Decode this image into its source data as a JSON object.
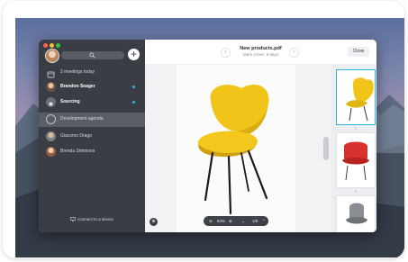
{
  "sidebar": {
    "items": [
      {
        "label": "2 meetings today",
        "bold": false
      },
      {
        "label": "Brandon Seager",
        "bold": true,
        "unread": true
      },
      {
        "label": "Sourcing",
        "bold": true,
        "unread": true
      },
      {
        "label": "Development agenda",
        "bold": false,
        "active": true
      },
      {
        "label": "Giacomo Drago",
        "bold": false
      },
      {
        "label": "Brenda Simmons",
        "bold": false
      }
    ],
    "connect_label": "Connect to a device",
    "compose_label": "+"
  },
  "viewer": {
    "title": "New products.pdf",
    "subtitle": "Mark Jones, 8 days",
    "close_label": "Close",
    "zoom": "84%",
    "page_indicator": "1/6",
    "thumb_numbers": [
      "1",
      "2"
    ]
  },
  "colors": {
    "accent": "#2fb5e9",
    "sidebar_bg": "#3a3d44",
    "chair_yellow": "#f0c419",
    "chair_red": "#d8312d",
    "chair_gray": "#8a8d92"
  },
  "icons": [
    "search-icon",
    "plus-icon",
    "calendar-icon",
    "chevron-left-icon",
    "chevron-right-icon",
    "monitor-icon",
    "zoom-icon",
    "download-icon"
  ]
}
